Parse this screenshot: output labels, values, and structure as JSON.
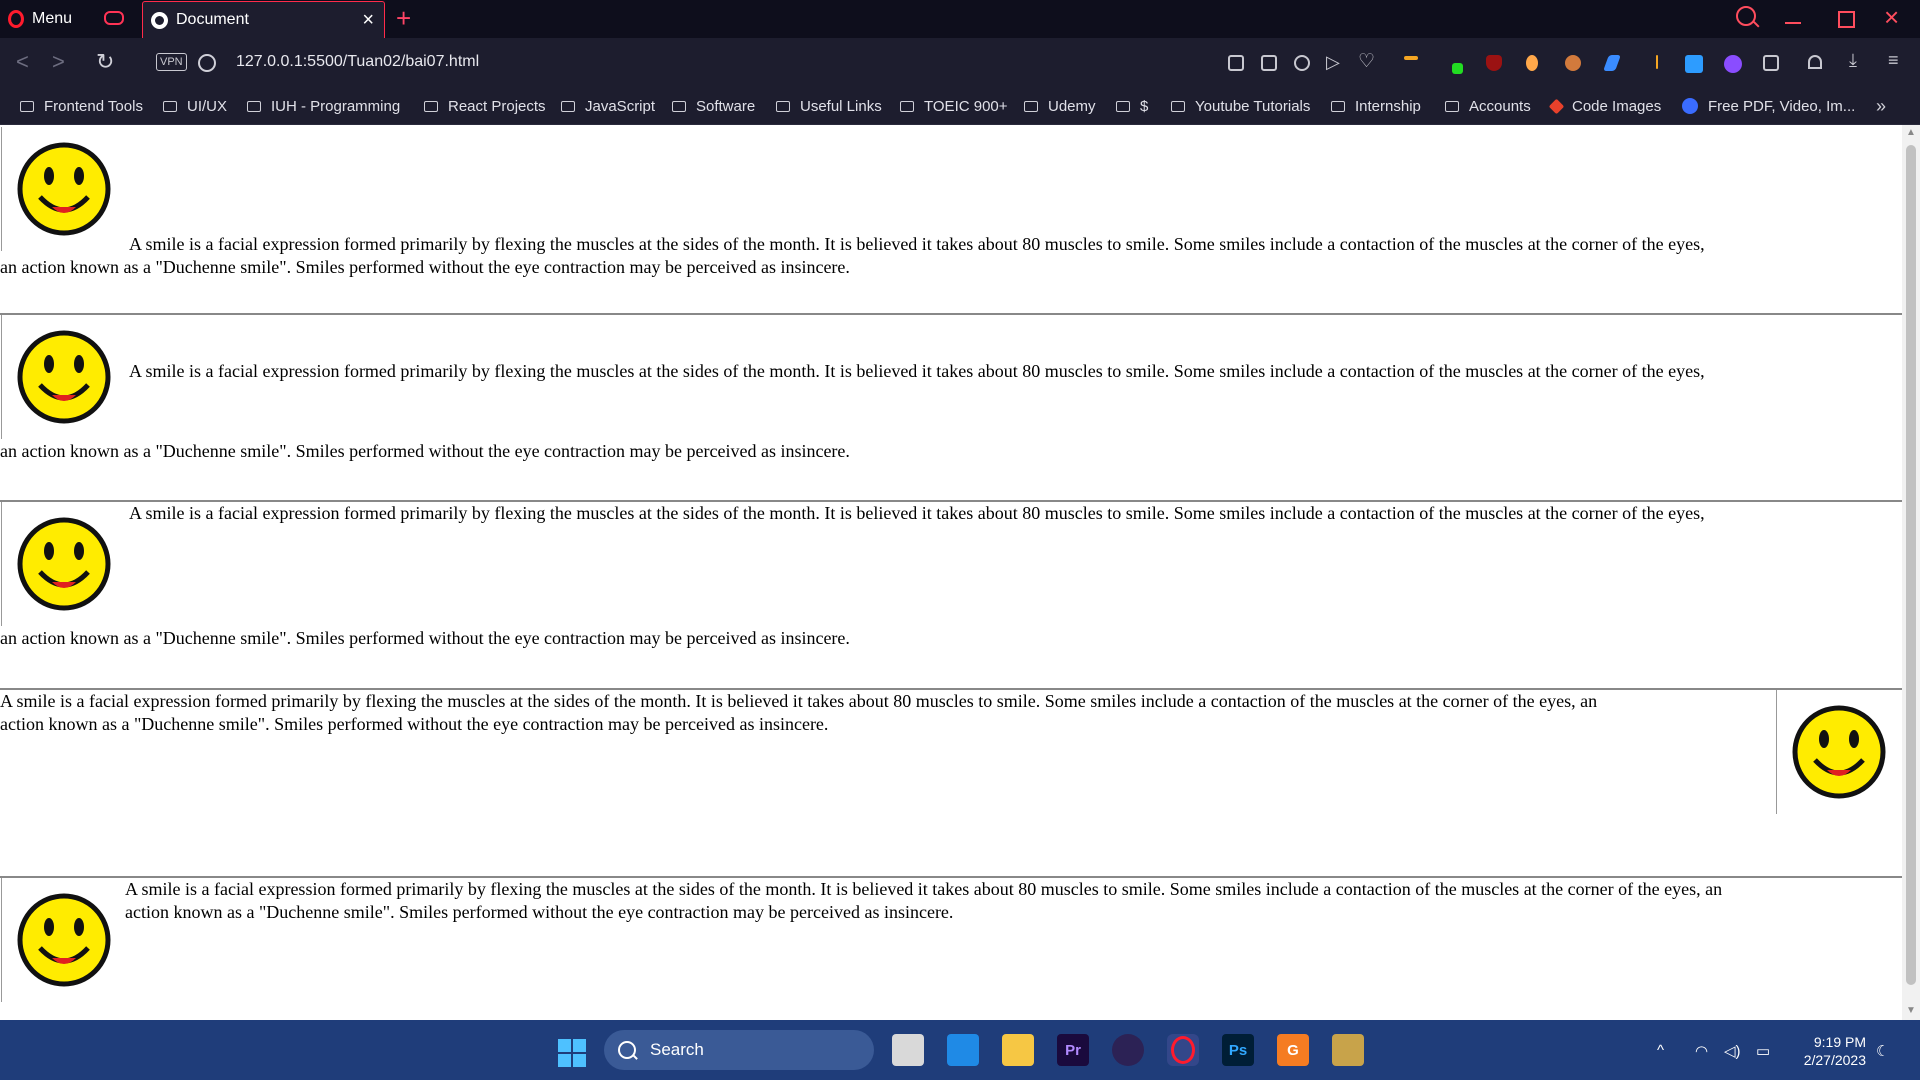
{
  "browser": {
    "menu_label": "Menu",
    "tab_title": "Document",
    "url": "127.0.0.1:5500/Tuan02/bai07.html",
    "vpn_label": "VPN"
  },
  "bookmarks": [
    {
      "label": "Frontend Tools",
      "icon": "folder-icon"
    },
    {
      "label": "UI/UX",
      "icon": "folder-icon"
    },
    {
      "label": "IUH - Programming",
      "icon": "folder-icon"
    },
    {
      "label": "React Projects",
      "icon": "folder-icon"
    },
    {
      "label": "JavaScript",
      "icon": "folder-icon"
    },
    {
      "label": "Software",
      "icon": "folder-icon"
    },
    {
      "label": "Useful Links",
      "icon": "folder-icon"
    },
    {
      "label": "TOEIC 900+",
      "icon": "folder-icon"
    },
    {
      "label": "Udemy",
      "icon": "folder-icon"
    },
    {
      "label": "$",
      "icon": "folder-icon"
    },
    {
      "label": "Youtube Tutorials",
      "icon": "folder-icon"
    },
    {
      "label": "Internship",
      "icon": "folder-icon"
    },
    {
      "label": "Accounts",
      "icon": "folder-icon"
    },
    {
      "label": "Code Images",
      "icon": "code-images-icon"
    },
    {
      "label": "Free PDF, Video, Im...",
      "icon": "pdf-tool-icon"
    }
  ],
  "page": {
    "paragraph_text": "A smile is a facial expression formed primarily by flexing the muscles at the sides of the month. It is believed it takes about 80 muscles to smile. Some smiles include a contaction of the muscles at the corner of the eyes, an action known as a \"Duchenne smile\". Smiles performed without the eye contraction may be perceived as insincere.",
    "line1_a": "A smile is a facial expression formed primarily by flexing the muscles at the sides of the month. It is believed it takes about 80 muscles to smile. Some smiles include a contaction of the muscles at the corner of the eyes,",
    "line2_a": "an action known as a \"Duchenne smile\". Smiles performed without the eye contraction may be perceived as insincere.",
    "line1_b": "A smile is a facial expression formed primarily by flexing the muscles at the sides of the month. It is believed it takes about 80 muscles to smile. Some smiles include a contaction of the muscles at the corner of the eyes, an",
    "line2_b": "action known as a \"Duchenne smile\". Smiles performed without the eye contraction may be perceived as insincere."
  },
  "taskbar": {
    "search_label": "Search",
    "time": "9:19 PM",
    "date": "2/27/2023",
    "apps": [
      "file-manager",
      "vscode",
      "file-explorer",
      "premiere-pro",
      "eclipse",
      "opera",
      "photoshop",
      "pdf-editor",
      "app-icon"
    ]
  },
  "colors": {
    "chrome_dark": "#0e0e1c",
    "chrome": "#1d1d2e",
    "opera_red": "#ff1b2d",
    "smiley_yellow": "#ffec00",
    "taskbar": "#1f3d7a"
  }
}
